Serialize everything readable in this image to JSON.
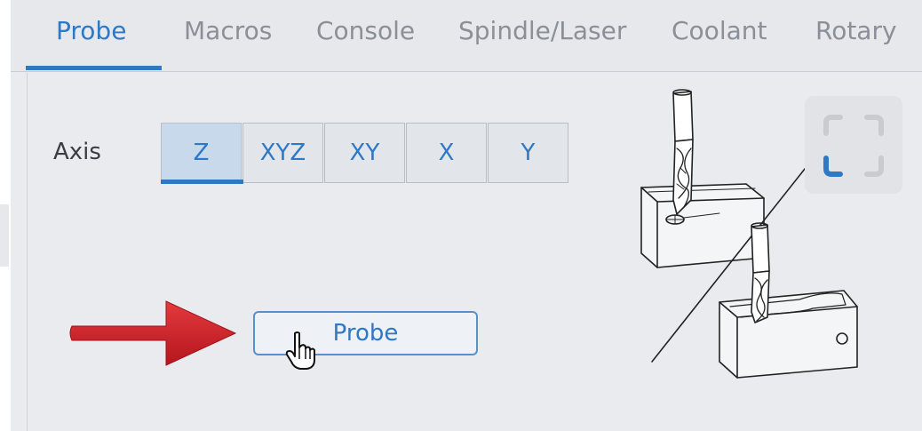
{
  "tabs": [
    {
      "label": "Probe",
      "active": true
    },
    {
      "label": "Macros",
      "active": false
    },
    {
      "label": "Console",
      "active": false
    },
    {
      "label": "Spindle/Laser",
      "active": false
    },
    {
      "label": "Coolant",
      "active": false
    },
    {
      "label": "Rotary",
      "active": false
    }
  ],
  "probe": {
    "axis_label": "Axis",
    "axis_options": [
      "Z",
      "XYZ",
      "XY",
      "X",
      "Y"
    ],
    "selected_axis": "Z",
    "probe_button_label": "Probe"
  },
  "colors": {
    "accent": "#2f78c4",
    "arrow": "#d3202a",
    "panel_bg": "#e9ebef",
    "fullscreen_blue": "#2f78c4"
  },
  "icons": {
    "fullscreen": "fullscreen-icon",
    "cursor": "hand-pointer-icon",
    "arrow": "arrow-right-icon",
    "illustration": "probe-illustration"
  }
}
